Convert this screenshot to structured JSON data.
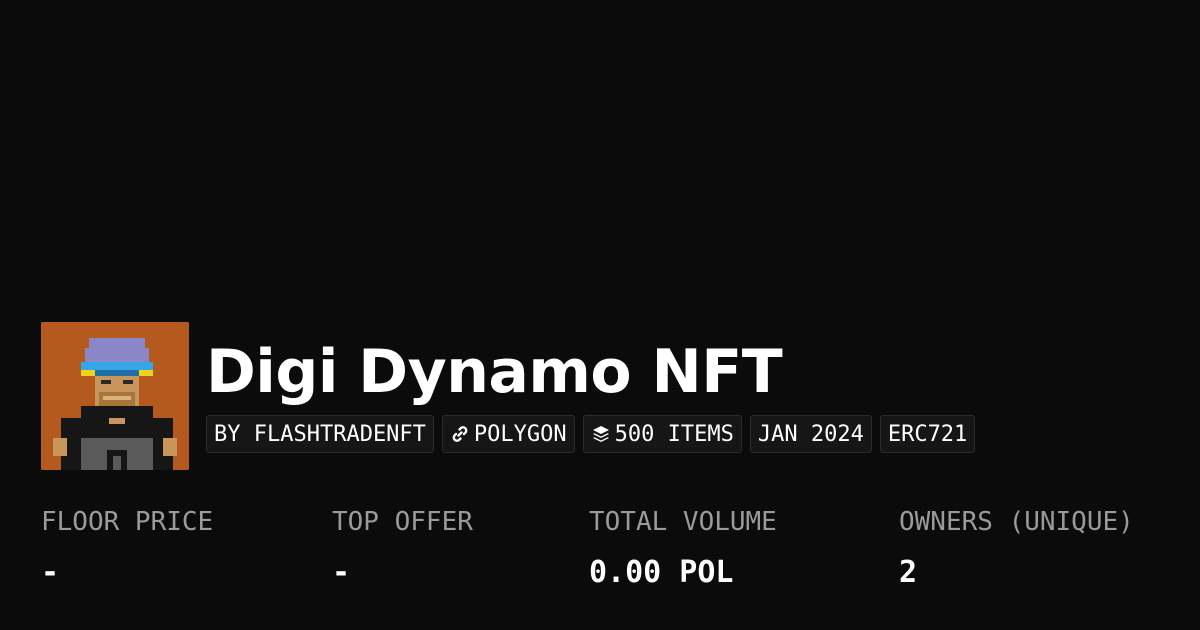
{
  "collection": {
    "title": "Digi Dynamo NFT",
    "avatar_alt": "pixel-art character wearing a blue beanie and yellow-blue visor"
  },
  "tags": {
    "creator": "BY FLASHTRADENFT",
    "chain": "POLYGON",
    "items": "500 ITEMS",
    "date": "JAN 2024",
    "standard": "ERC721"
  },
  "icons": {
    "chain": "link-icon",
    "items": "layers-icon"
  },
  "stats": [
    {
      "label": "FLOOR PRICE",
      "value": "-"
    },
    {
      "label": "TOP OFFER",
      "value": "-"
    },
    {
      "label": "TOTAL VOLUME",
      "value": "0.00 POL"
    },
    {
      "label": "OWNERS (UNIQUE)",
      "value": "2"
    }
  ],
  "colors": {
    "background": "#0b0b0b",
    "avatar_background": "#b55a1e",
    "label_gray": "#9a9a9a"
  }
}
